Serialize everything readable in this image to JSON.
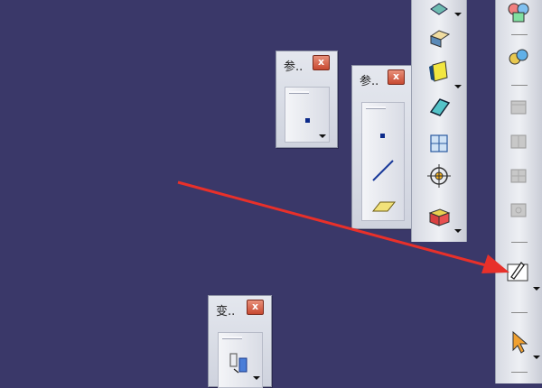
{
  "panel_reference_small": {
    "title": "参..",
    "close_label": "x"
  },
  "panel_reference_large": {
    "title": "参..",
    "close_label": "x"
  },
  "panel_transform": {
    "title": "变..",
    "close_label": "x"
  },
  "colors": {
    "background": "#3a3869",
    "annotation_arrow": "#e8302a",
    "close_button": "#c84a32",
    "panel": "#dfe2ea"
  },
  "icons": {
    "reference_small": [
      "point-icon"
    ],
    "reference_large": [
      "point-icon",
      "line-icon",
      "plane-icon"
    ],
    "transform": [
      "translate-icon"
    ],
    "solid_tools": [
      "pad-icon",
      "pocket-icon",
      "thickness-icon",
      "surface-icon",
      "shell-icon",
      "target-icon",
      "remove-icon"
    ],
    "right_toolbar": [
      "assembly-icon",
      "constraint-icon",
      "part-gray-1-icon",
      "part-gray-2-icon",
      "part-gray-3-icon",
      "part-gray-4-icon",
      "sketcher-icon",
      "select-arrow-icon"
    ]
  }
}
